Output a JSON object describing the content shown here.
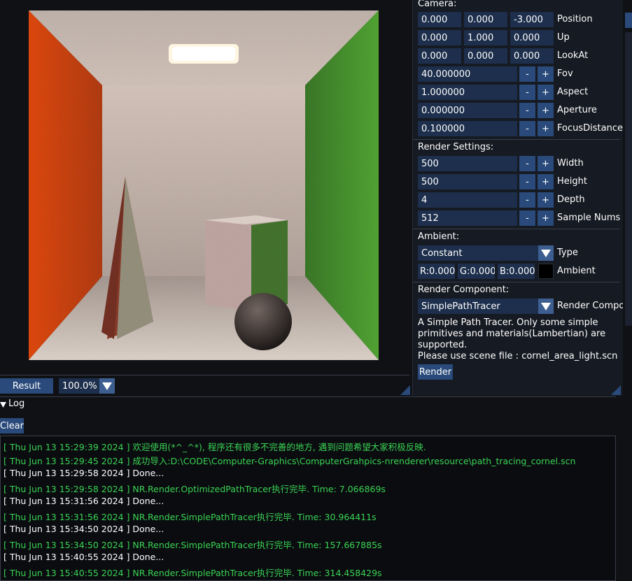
{
  "colors": {
    "accent": "#294a7a",
    "field_bg": "#1d2f4c",
    "log_green": "#39d353",
    "log_white": "#ffffff",
    "wall_left": "#c8400f",
    "wall_right": "#3f8a2a",
    "floor": "#c9beb4"
  },
  "result_bar": {
    "result_label": "Result",
    "zoom_value": "100.0%"
  },
  "camera": {
    "section_label": "Camera:",
    "position": {
      "x": "0.000",
      "y": "0.000",
      "z": "-3.000",
      "label": "Position"
    },
    "up": {
      "x": "0.000",
      "y": "1.000",
      "z": "0.000",
      "label": "Up"
    },
    "lookat": {
      "x": "0.000",
      "y": "0.000",
      "z": "0.000",
      "label": "LookAt"
    },
    "fov": {
      "value": "40.000000",
      "label": "Fov"
    },
    "aspect": {
      "value": "1.000000",
      "label": "Aspect"
    },
    "aperture": {
      "value": "0.000000",
      "label": "Aperture"
    },
    "focus": {
      "value": "0.100000",
      "label": "FocusDistance"
    }
  },
  "render_settings": {
    "section_label": "Render Settings:",
    "width": {
      "value": "500",
      "label": "Width"
    },
    "height": {
      "value": "500",
      "label": "Height"
    },
    "depth": {
      "value": "4",
      "label": "Depth"
    },
    "samples": {
      "value": "512",
      "label": "Sample Nums"
    }
  },
  "ambient": {
    "section_label": "Ambient:",
    "type_value": "Constant",
    "type_label": "Type",
    "r": "R:0.000",
    "g": "G:0.000",
    "b": "B:0.000",
    "ambient_label": "Ambient",
    "swatch_color": "#000000"
  },
  "render_component": {
    "section_label": "Render Component:",
    "value": "SimplePathTracer",
    "label": "Render Compone",
    "description_lines": [
      "A Simple Path Tracer. Only some simple",
      "primitives and materials(Lambertian) are",
      "supported.",
      "Please use scene file : cornel_area_light.scn"
    ],
    "render_button": "Render"
  },
  "log": {
    "header": "Log",
    "clear_button": "Clear",
    "lines": [
      {
        "text": "[ Thu Jun 13 15:29:39 2024 ] 欢迎使用(*^_^*), 程序还有很多不完善的地方, 遇到问题希望大家积极反映.",
        "level": "green"
      },
      {
        "text": "[ Thu Jun 13 15:29:45 2024 ] 成功导入:D:\\CODE\\Computer-Graphics\\ComputerGrahpics-nrenderer\\resource\\path_tracing_cornel.scn",
        "level": "green"
      },
      {
        "text": "[ Thu Jun 13 15:29:58 2024 ] Done...",
        "level": "white"
      },
      {
        "text": "[ Thu Jun 13 15:29:58 2024 ] NR.Render.OptimizedPathTracer执行完毕. Time: 7.066869s",
        "level": "green"
      },
      {
        "text": "[ Thu Jun 13 15:31:56 2024 ] Done...",
        "level": "white"
      },
      {
        "text": "[ Thu Jun 13 15:31:56 2024 ] NR.Render.SimplePathTracer执行完毕. Time: 30.964411s",
        "level": "green"
      },
      {
        "text": "[ Thu Jun 13 15:34:50 2024 ] Done...",
        "level": "white"
      },
      {
        "text": "[ Thu Jun 13 15:34:50 2024 ] NR.Render.SimplePathTracer执行完毕. Time: 157.667885s",
        "level": "green"
      },
      {
        "text": "[ Thu Jun 13 15:40:55 2024 ] Done...",
        "level": "white"
      },
      {
        "text": "[ Thu Jun 13 15:40:55 2024 ] NR.Render.SimplePathTracer执行完毕. Time: 314.458429s",
        "level": "green"
      }
    ]
  }
}
